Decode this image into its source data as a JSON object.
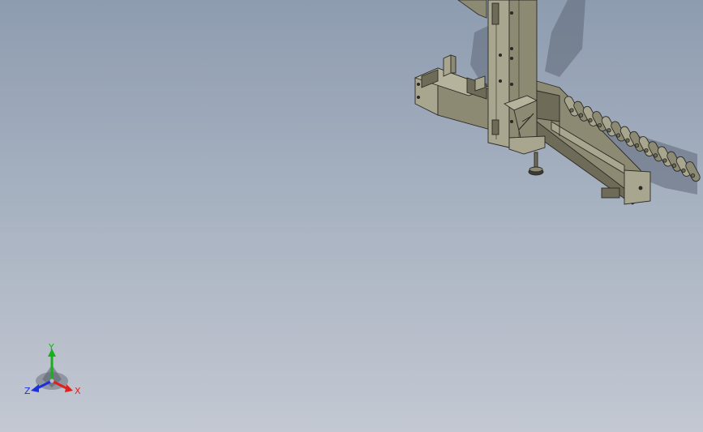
{
  "viewport": {
    "background_top": "#8e9cb0",
    "background_bottom": "#c3c8d2"
  },
  "model": {
    "part_color": "#8d8a74",
    "part_light": "#a9a68f",
    "part_dark": "#6e6b58",
    "edge_color": "#2b2a24",
    "shadow_color": "#5e6776"
  },
  "triad": {
    "x_label": "X",
    "y_label": "Y",
    "z_label": "Z",
    "x_color": "#e0201c",
    "y_color": "#19b11b",
    "z_color": "#1c2fe0"
  }
}
